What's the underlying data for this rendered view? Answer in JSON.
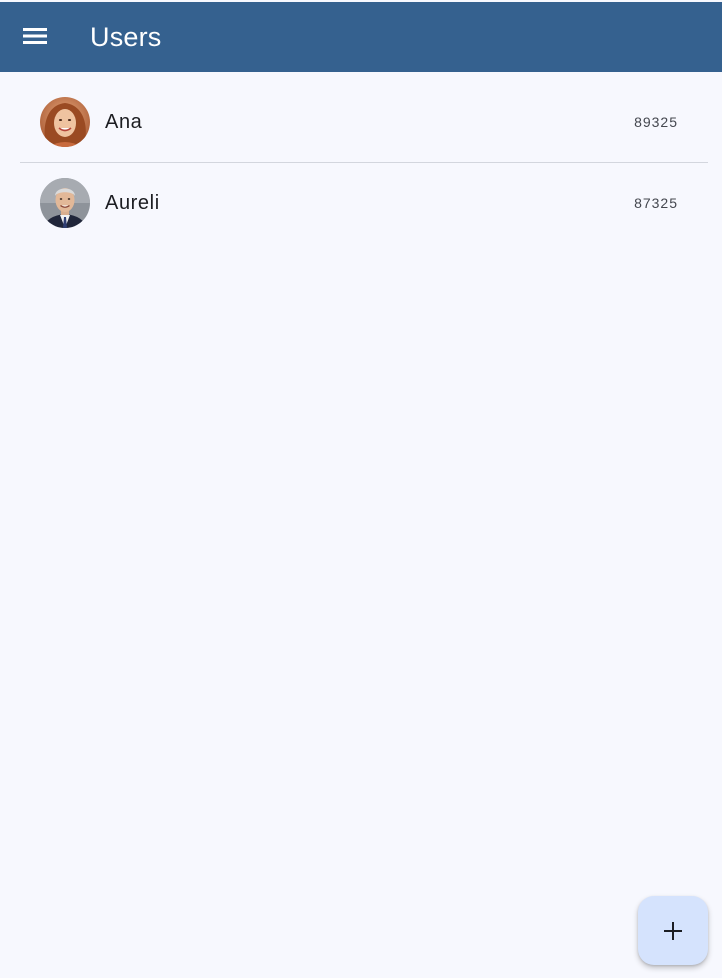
{
  "header": {
    "title": "Users",
    "menu_icon": "menu-icon"
  },
  "users": [
    {
      "name": "Ana",
      "value": "89325",
      "avatar_icon": "user-photo"
    },
    {
      "name": "Aureli",
      "value": "87325",
      "avatar_icon": "user-photo"
    }
  ],
  "fab": {
    "icon": "add-icon"
  },
  "colors": {
    "app_bar": "#35618F",
    "background": "#F7F8FE",
    "fab": "#D5E3FD",
    "divider": "#D3D6DE"
  }
}
